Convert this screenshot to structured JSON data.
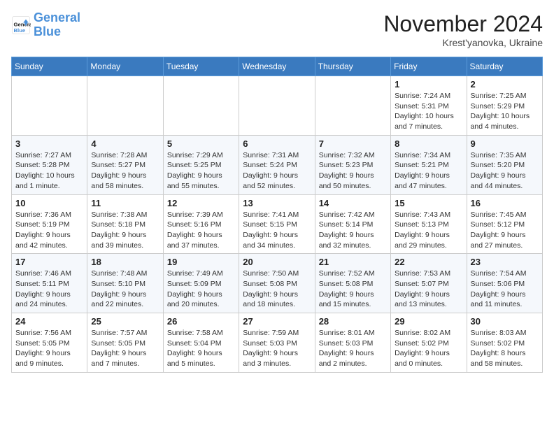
{
  "header": {
    "logo_general": "General",
    "logo_blue": "Blue",
    "month_title": "November 2024",
    "location": "Krest'yanovka, Ukraine"
  },
  "weekdays": [
    "Sunday",
    "Monday",
    "Tuesday",
    "Wednesday",
    "Thursday",
    "Friday",
    "Saturday"
  ],
  "weeks": [
    [
      {
        "day": "",
        "info": ""
      },
      {
        "day": "",
        "info": ""
      },
      {
        "day": "",
        "info": ""
      },
      {
        "day": "",
        "info": ""
      },
      {
        "day": "",
        "info": ""
      },
      {
        "day": "1",
        "info": "Sunrise: 7:24 AM\nSunset: 5:31 PM\nDaylight: 10 hours and 7 minutes."
      },
      {
        "day": "2",
        "info": "Sunrise: 7:25 AM\nSunset: 5:29 PM\nDaylight: 10 hours and 4 minutes."
      }
    ],
    [
      {
        "day": "3",
        "info": "Sunrise: 7:27 AM\nSunset: 5:28 PM\nDaylight: 10 hours and 1 minute."
      },
      {
        "day": "4",
        "info": "Sunrise: 7:28 AM\nSunset: 5:27 PM\nDaylight: 9 hours and 58 minutes."
      },
      {
        "day": "5",
        "info": "Sunrise: 7:29 AM\nSunset: 5:25 PM\nDaylight: 9 hours and 55 minutes."
      },
      {
        "day": "6",
        "info": "Sunrise: 7:31 AM\nSunset: 5:24 PM\nDaylight: 9 hours and 52 minutes."
      },
      {
        "day": "7",
        "info": "Sunrise: 7:32 AM\nSunset: 5:23 PM\nDaylight: 9 hours and 50 minutes."
      },
      {
        "day": "8",
        "info": "Sunrise: 7:34 AM\nSunset: 5:21 PM\nDaylight: 9 hours and 47 minutes."
      },
      {
        "day": "9",
        "info": "Sunrise: 7:35 AM\nSunset: 5:20 PM\nDaylight: 9 hours and 44 minutes."
      }
    ],
    [
      {
        "day": "10",
        "info": "Sunrise: 7:36 AM\nSunset: 5:19 PM\nDaylight: 9 hours and 42 minutes."
      },
      {
        "day": "11",
        "info": "Sunrise: 7:38 AM\nSunset: 5:18 PM\nDaylight: 9 hours and 39 minutes."
      },
      {
        "day": "12",
        "info": "Sunrise: 7:39 AM\nSunset: 5:16 PM\nDaylight: 9 hours and 37 minutes."
      },
      {
        "day": "13",
        "info": "Sunrise: 7:41 AM\nSunset: 5:15 PM\nDaylight: 9 hours and 34 minutes."
      },
      {
        "day": "14",
        "info": "Sunrise: 7:42 AM\nSunset: 5:14 PM\nDaylight: 9 hours and 32 minutes."
      },
      {
        "day": "15",
        "info": "Sunrise: 7:43 AM\nSunset: 5:13 PM\nDaylight: 9 hours and 29 minutes."
      },
      {
        "day": "16",
        "info": "Sunrise: 7:45 AM\nSunset: 5:12 PM\nDaylight: 9 hours and 27 minutes."
      }
    ],
    [
      {
        "day": "17",
        "info": "Sunrise: 7:46 AM\nSunset: 5:11 PM\nDaylight: 9 hours and 24 minutes."
      },
      {
        "day": "18",
        "info": "Sunrise: 7:48 AM\nSunset: 5:10 PM\nDaylight: 9 hours and 22 minutes."
      },
      {
        "day": "19",
        "info": "Sunrise: 7:49 AM\nSunset: 5:09 PM\nDaylight: 9 hours and 20 minutes."
      },
      {
        "day": "20",
        "info": "Sunrise: 7:50 AM\nSunset: 5:08 PM\nDaylight: 9 hours and 18 minutes."
      },
      {
        "day": "21",
        "info": "Sunrise: 7:52 AM\nSunset: 5:08 PM\nDaylight: 9 hours and 15 minutes."
      },
      {
        "day": "22",
        "info": "Sunrise: 7:53 AM\nSunset: 5:07 PM\nDaylight: 9 hours and 13 minutes."
      },
      {
        "day": "23",
        "info": "Sunrise: 7:54 AM\nSunset: 5:06 PM\nDaylight: 9 hours and 11 minutes."
      }
    ],
    [
      {
        "day": "24",
        "info": "Sunrise: 7:56 AM\nSunset: 5:05 PM\nDaylight: 9 hours and 9 minutes."
      },
      {
        "day": "25",
        "info": "Sunrise: 7:57 AM\nSunset: 5:05 PM\nDaylight: 9 hours and 7 minutes."
      },
      {
        "day": "26",
        "info": "Sunrise: 7:58 AM\nSunset: 5:04 PM\nDaylight: 9 hours and 5 minutes."
      },
      {
        "day": "27",
        "info": "Sunrise: 7:59 AM\nSunset: 5:03 PM\nDaylight: 9 hours and 3 minutes."
      },
      {
        "day": "28",
        "info": "Sunrise: 8:01 AM\nSunset: 5:03 PM\nDaylight: 9 hours and 2 minutes."
      },
      {
        "day": "29",
        "info": "Sunrise: 8:02 AM\nSunset: 5:02 PM\nDaylight: 9 hours and 0 minutes."
      },
      {
        "day": "30",
        "info": "Sunrise: 8:03 AM\nSunset: 5:02 PM\nDaylight: 8 hours and 58 minutes."
      }
    ]
  ]
}
